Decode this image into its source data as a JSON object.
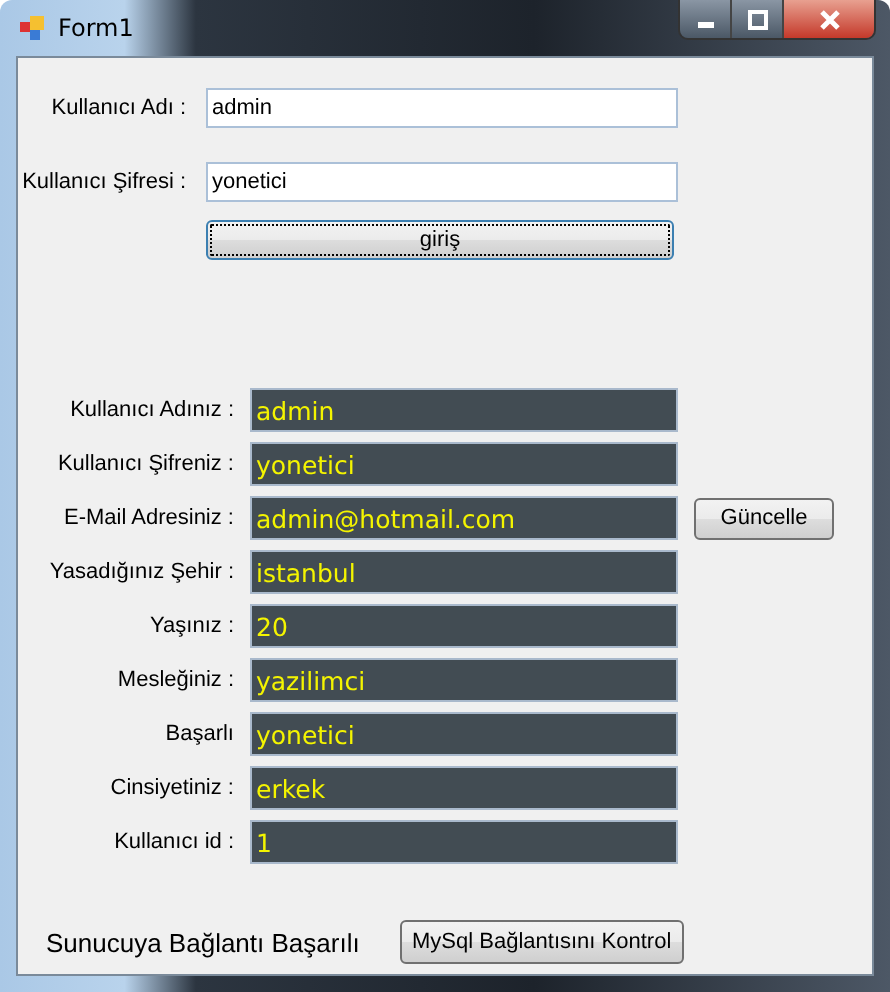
{
  "window": {
    "title": "Form1"
  },
  "login": {
    "fields": [
      {
        "label": "Kullanıcı Adı :",
        "value": "admin"
      },
      {
        "label": "Kullanıcı Şifresi :",
        "value": "yonetici"
      }
    ],
    "button": "giriş"
  },
  "profile": [
    {
      "label": "Kullanıcı Adınız :",
      "value": "admin"
    },
    {
      "label": "Kullanıcı Şifreniz :",
      "value": "yonetici"
    },
    {
      "label": "E-Mail Adresiniz :",
      "value": "admin@hotmail.com",
      "button": "Güncelle"
    },
    {
      "label": "Yasadığınız Şehir :",
      "value": "istanbul"
    },
    {
      "label": "Yaşınız :",
      "value": "20"
    },
    {
      "label": "Mesleğiniz :",
      "value": "yazilimci"
    },
    {
      "label": "Başarlı",
      "value": "yonetici"
    },
    {
      "label": "Cinsiyetiniz :",
      "value": "erkek"
    },
    {
      "label": "Kullanıcı id :",
      "value": "1"
    }
  ],
  "footer": {
    "status": "Sunucuya Bağlantı Başarılı",
    "button": "MySql Bağlantısını Kontrol"
  }
}
